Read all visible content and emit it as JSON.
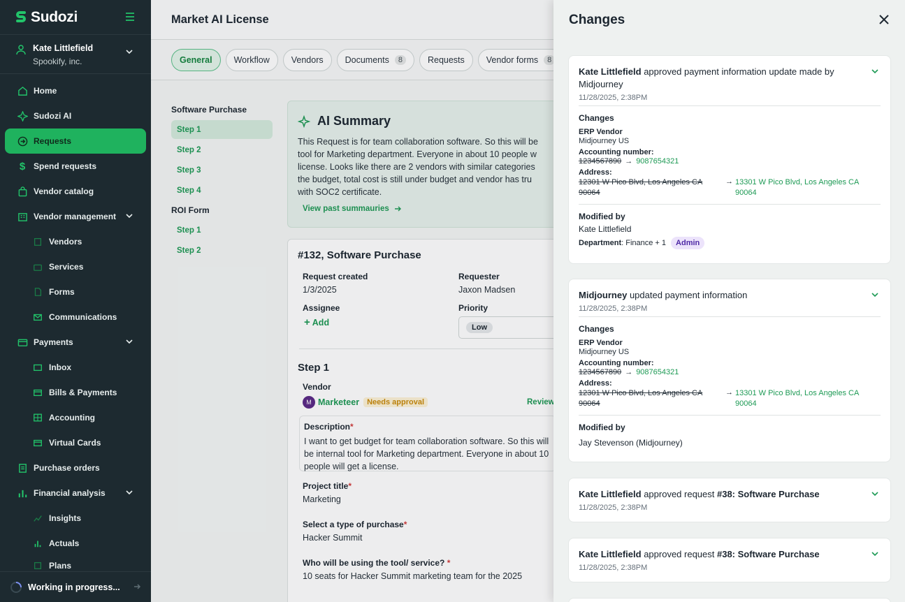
{
  "app": {
    "name": "Sudozi"
  },
  "user": {
    "name": "Kate Littlefield",
    "org": "Spookify, inc."
  },
  "nav": {
    "home": "Home",
    "ai": "Sudozi AI",
    "requests": "Requests",
    "spend": "Spend requests",
    "catalog": "Vendor catalog",
    "vendor_mgmt": "Vendor management",
    "vendors": "Vendors",
    "services": "Services",
    "forms": "Forms",
    "communications": "Communications",
    "payments": "Payments",
    "inbox": "Inbox",
    "bills": "Bills & Payments",
    "accounting": "Accounting",
    "virtual_cards": "Virtual Cards",
    "purchase_orders": "Purchase orders",
    "financial": "Financial analysis",
    "insights": "Insights",
    "actuals": "Actuals",
    "plans": "Plans"
  },
  "status": {
    "working": "Working in progress..."
  },
  "page": {
    "title": "Market AI License"
  },
  "tabs": {
    "general": "General",
    "workflow": "Workflow",
    "vendors": "Vendors",
    "documents": "Documents",
    "documents_count": "8",
    "requests": "Requests",
    "vendor_forms": "Vendor forms",
    "vendor_forms_count": "8"
  },
  "steps": {
    "group1": "Software Purchase",
    "s1": "Step 1",
    "s2": "Step 2",
    "s3": "Step 3",
    "s4": "Step 4",
    "group2": "ROI Form",
    "r1": "Step 1",
    "r2": "Step 2"
  },
  "ai_summary": {
    "title": "AI Summary",
    "line1": "This Request is for team collaboration software. So this will be",
    "line2": "tool for Marketing department. Everyone in about 10 people w",
    "line3": "license. Looks like there are 2 vendors with similar categories",
    "line4": "the budget, total cost is still under budget and vendor has tru",
    "line5": "with SOC2 certificate.",
    "link": "View past summauries"
  },
  "request": {
    "title": "#132, Software Purchase",
    "created_label": "Request created",
    "created": "1/3/2025",
    "requester_label": "Requester",
    "requester": "Jaxon Madsen",
    "assignee_label": "Assignee",
    "add": "Add",
    "priority_label": "Priority",
    "priority": "Low",
    "step_title": "Step 1",
    "vendor_label": "Vendor",
    "vendor_initial": "M",
    "vendor_name": "Marketeer",
    "vendor_status": "Needs approval",
    "review": "Review",
    "desc_label": "Description",
    "desc_line1": "I want to get budget for team collaboration software. So this will",
    "desc_line2": "be internal tool for Marketing department. Everyone in about 10",
    "desc_line3": "people will get a license.",
    "project_label": "Project title",
    "project": "Marketing",
    "purchase_label": "Select a type of purchase",
    "purchase": "Hacker Summit",
    "who_label": "Who will be using the tool/ service?",
    "who": "10 seats for Hacker Summit marketing team for the 2025",
    "asterisk": "*"
  },
  "panel": {
    "title": "Changes",
    "entries": [
      {
        "actor": "Kate Littlefield",
        "action": " approved payment information update made by Midjourney",
        "time": "11/28/2025, 2:38PM",
        "changes": "Changes",
        "erp_label": "ERP Vendor",
        "erp": "Midjourney US",
        "acc_label": "Accounting number:",
        "acc_old": "1234567890",
        "acc_new": "9087654321",
        "addr_label": "Address:",
        "addr_old": "12301 W Pico Blvd, Los Angeles CA 90064",
        "addr_new": "13301 W Pico Blvd, Los Angeles CA 90064",
        "mod_label": "Modified by",
        "mod_name": "Kate Littlefield",
        "dept_label": "Department",
        "dept": ": Finance + 1",
        "role": "Admin"
      },
      {
        "actor": "Midjourney",
        "action": " updated payment information",
        "time": "11/28/2025, 2:38PM",
        "changes": "Changes",
        "erp_label": "ERP Vendor",
        "erp": "Midjourney US",
        "acc_label": "Accounting number:",
        "acc_old": "1234567890",
        "acc_new": "9087654321",
        "addr_label": "Address:",
        "addr_old": "12301 W Pico Blvd, Los Angeles CA 90064",
        "addr_new": "13301 W Pico Blvd, Los Angeles CA 90064",
        "mod_label": "Modified by",
        "mod_name": "Jay Stevenson (Midjourney)"
      },
      {
        "actor": "Kate Littlefield",
        "action": " approved request ",
        "target": "#38: Software Purchase",
        "time": "11/28/2025, 2:38PM"
      },
      {
        "actor": "Kate Littlefield",
        "action": " approved request ",
        "target": "#38: Software Purchase",
        "time": "11/28/2025, 2:38PM"
      }
    ]
  }
}
